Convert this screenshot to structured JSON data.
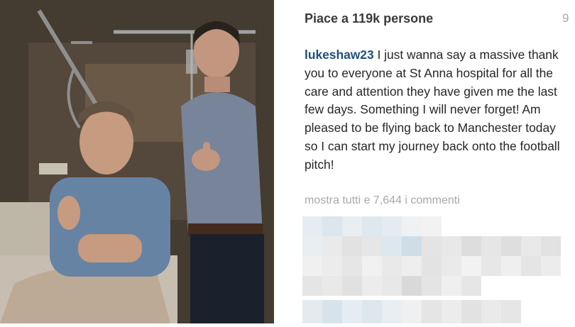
{
  "post": {
    "likes": "Piace a 119k persone",
    "time": "9",
    "username": "lukeshaw23",
    "caption": "I just wanna say a massive thank you to everyone at St Anna hospital for all the care and attention they have given me the last few days. Something I will never forget! Am pleased to be flying back to Manchester today so I can start my journey back onto the football pitch!",
    "view_comments": "mostra tutti e 7,644 i commenti"
  },
  "colors": {
    "username": "#1f4f7a",
    "likes": "#3a3a3a",
    "muted": "#a8a8a8",
    "text": "#262626"
  },
  "icons": {
    "photo": "hospital-photo"
  }
}
